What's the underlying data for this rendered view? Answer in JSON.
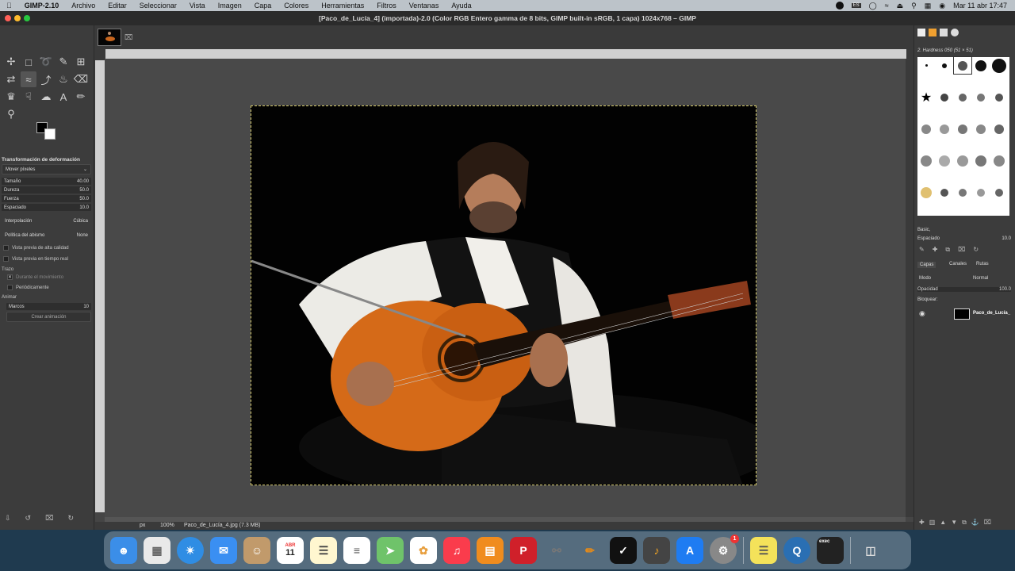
{
  "menubar": {
    "app": "GIMP-2.10",
    "items": [
      "Archivo",
      "Editar",
      "Seleccionar",
      "Vista",
      "Imagen",
      "Capa",
      "Colores",
      "Herramientas",
      "Filtros",
      "Ventanas",
      "Ayuda"
    ],
    "input_lang": "ES",
    "clock": "Mar 11 abr  17:47"
  },
  "window": {
    "title": "[Paco_de_Lucía_4] (importada)-2.0 (Color RGB Entero gamma de 8 bits, GIMP built-in sRGB, 1 capa) 1024x768 – GIMP"
  },
  "tool_options": {
    "title": "Transformación de deformación",
    "mode": "Mover píxeles",
    "size_label": "Tamaño",
    "size_value": "40.00",
    "hardness_label": "Dureza",
    "hardness_value": "50.0",
    "strength_label": "Fuerza",
    "strength_value": "50.0",
    "spacing_label": "Espaciado",
    "spacing_value": "10.0",
    "interp_label": "Interpolación",
    "interp_value": "Cúbica",
    "abyss_label": "Política del abismo",
    "abyss_value": "None",
    "hq_preview": "Vista previa de alta calidad",
    "rt_preview": "Vista previa en tiempo real",
    "stroke_label": "Trazo",
    "during_motion": "Durante el movimiento",
    "periodically": "Periódicamente",
    "animate_label": "Animar",
    "frames_label": "Marcos",
    "frames_value": "10",
    "create_anim": "Crear animación"
  },
  "status": {
    "unit": "px",
    "zoom": "100%",
    "file": "Paco_de_Lucía_4.jpg (7.3 MB)"
  },
  "brushes": {
    "current": "2. Hardness 050 (51 × 51)",
    "tag": "Basic,",
    "spacing_label": "Espaciado",
    "spacing_value": "10.0"
  },
  "layers": {
    "tab_layers": "Capas",
    "tab_channels": "Canales",
    "tab_paths": "Rutas",
    "mode_label": "Modo",
    "mode_value": "Normal",
    "opacity_label": "Opacidad",
    "opacity_value": "100.0",
    "lock_label": "Bloquear:",
    "layer_name": "Paco_de_Lucía_"
  },
  "dock": {
    "calendar_month": "ABR",
    "calendar_day": "11",
    "badge": "1",
    "terminal_text": "exec"
  }
}
